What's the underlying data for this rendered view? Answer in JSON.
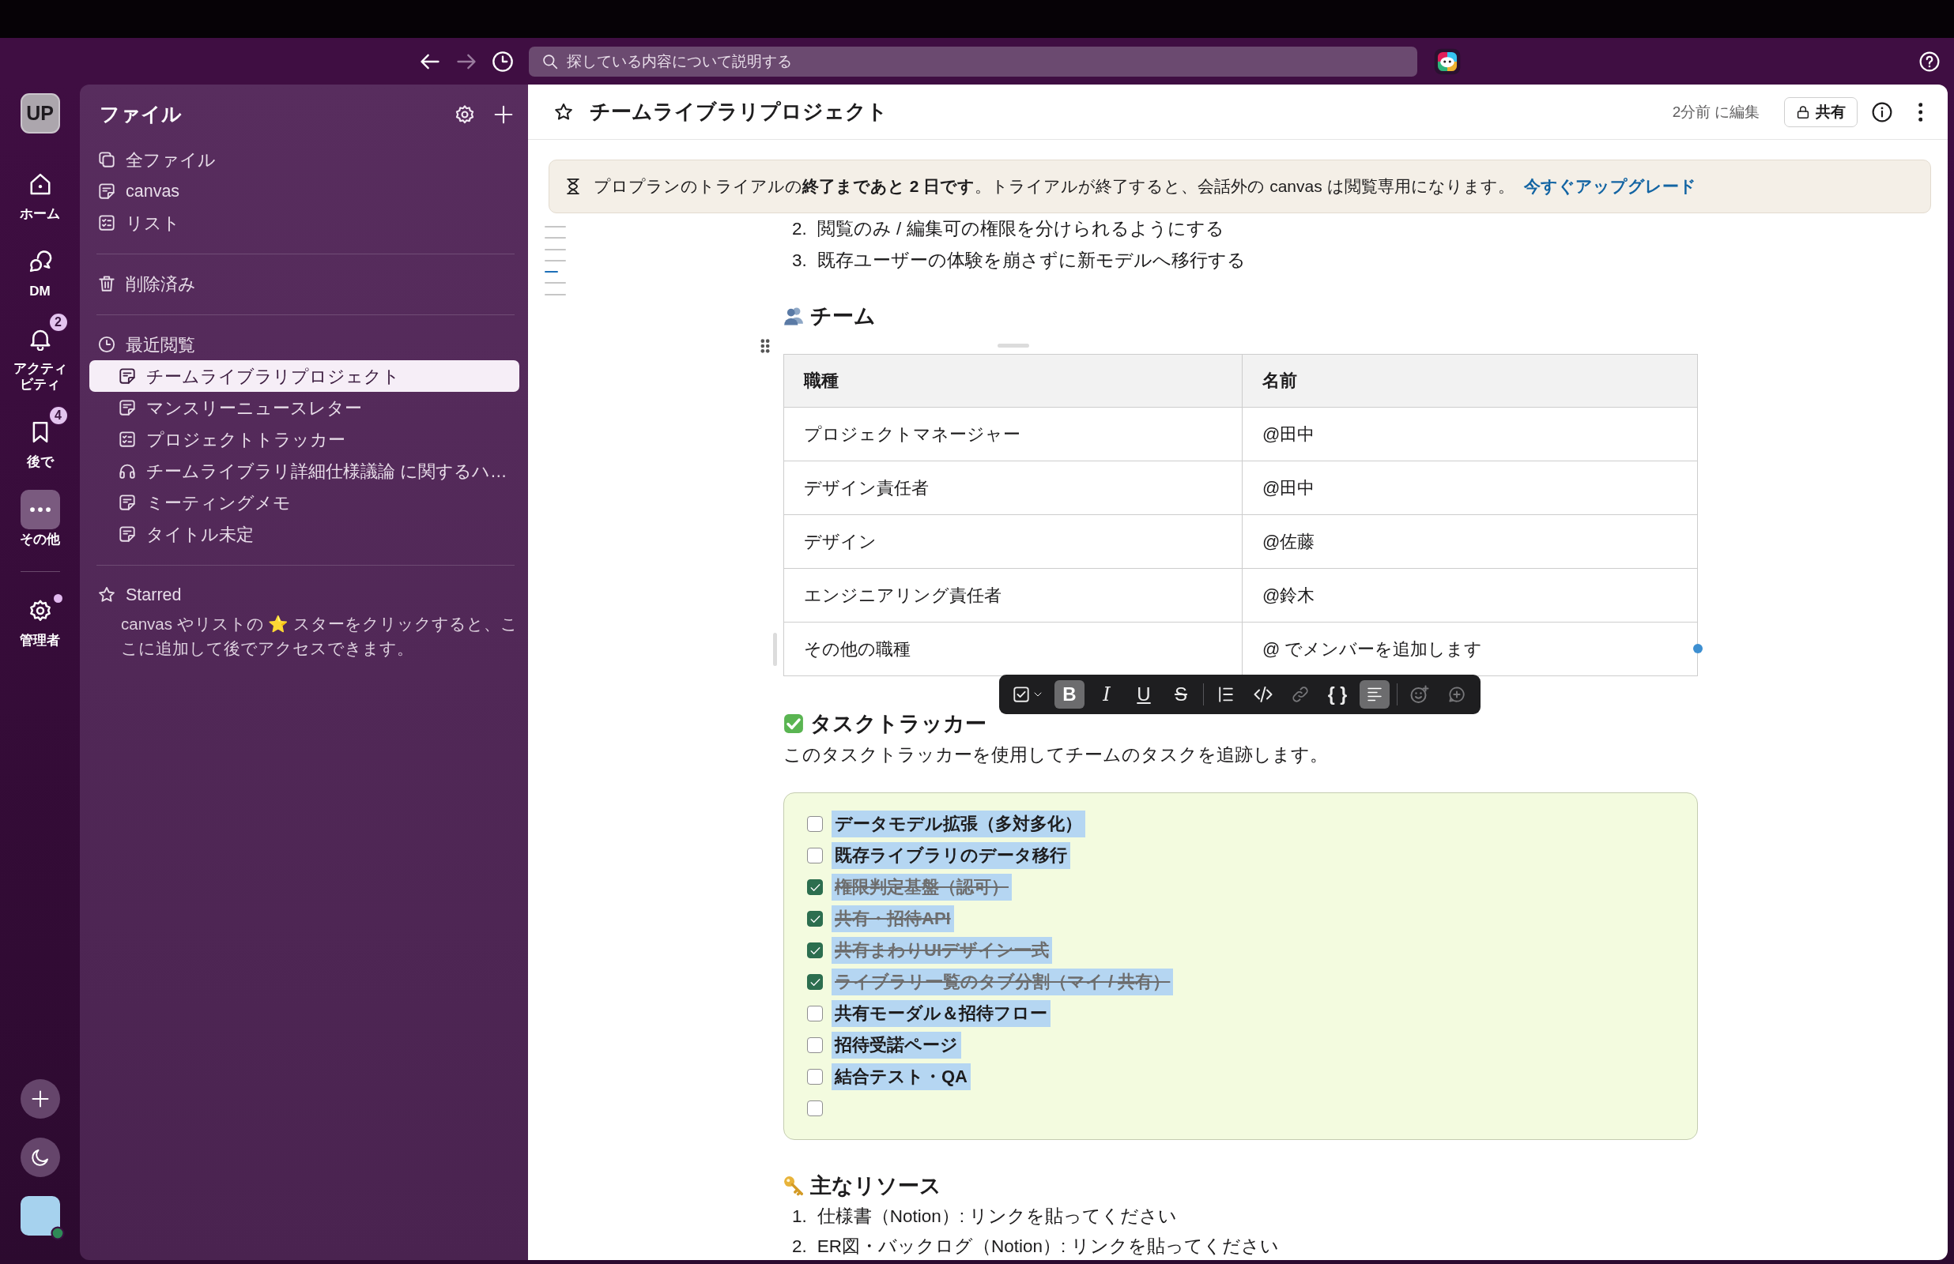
{
  "top_bar": {
    "nav": [
      {
        "kind": "back",
        "disabled": false
      },
      {
        "kind": "forward",
        "disabled": true
      },
      {
        "kind": "history",
        "disabled": false
      }
    ],
    "search": {
      "placeholder": "探している内容について説明する"
    }
  },
  "rail": {
    "workspace": "UP",
    "items": [
      {
        "kind": "home",
        "label": "ホーム",
        "selected": false
      },
      {
        "kind": "dm",
        "label": "DM",
        "selected": false
      },
      {
        "kind": "activity",
        "label": "アクティビティ",
        "badge": "2",
        "selected": false
      },
      {
        "kind": "later",
        "label": "後で",
        "badge": "4",
        "selected": false
      },
      {
        "kind": "more",
        "label": "その他",
        "selected": true
      }
    ],
    "admin": {
      "label": "管理者",
      "dot": true
    }
  },
  "sidebar": {
    "title": "ファイル",
    "items": [
      {
        "kind": "files",
        "label": "全ファイル",
        "selected": false
      },
      {
        "kind": "canvas",
        "label": "canvas",
        "selected": false
      },
      {
        "kind": "list",
        "label": "リスト",
        "selected": false
      }
    ],
    "trash": {
      "label": "削除済み",
      "selected": false
    },
    "recent": {
      "label": "最近閲覧",
      "items": [
        {
          "kind": "canvas",
          "label": "チームライブラリプロジェクト",
          "selected": true
        },
        {
          "kind": "canvas",
          "label": "マンスリーニュースレター",
          "selected": false
        },
        {
          "kind": "list",
          "label": "プロジェクトトラッカー",
          "selected": false
        },
        {
          "kind": "huddle",
          "label": "チームライブラリ詳細仕様議論 に関するハ…",
          "selected": false
        },
        {
          "kind": "canvas",
          "label": "ミーティングメモ",
          "selected": false
        },
        {
          "kind": "canvas",
          "label": "タイトル未定",
          "selected": false
        }
      ]
    },
    "starred": {
      "label": "Starred",
      "hint": "canvas やリストの ⭐ スターをクリックすると、ここに追加して後でアクセスできます。"
    }
  },
  "canvas": {
    "title": "チームライブラリプロジェクト",
    "edited": "2分前 に編集",
    "share": "共有",
    "banner": {
      "text": "プロプランのトライアルの**終了まであと 2 日です**。トライアルが終了すると、会話外の canvas は閲覧専用になります。",
      "link": "今すぐアップグレード"
    },
    "outline": [
      {
        "selected": false
      },
      {
        "selected": false
      },
      {
        "selected": false
      },
      {
        "selected": false
      },
      {
        "selected": true
      },
      {
        "selected": false
      },
      {
        "selected": false
      }
    ],
    "goals": [
      {
        "marker": "2.",
        "text": "閲覧のみ / 編集可の権限を分けられるようにする"
      },
      {
        "marker": "3.",
        "text": "既存ユーザーの体験を崩さずに新モデルへ移行する"
      }
    ],
    "team": {
      "heading": "チーム",
      "table": {
        "columns": [
          "職種",
          "名前"
        ],
        "rows": [
          [
            "プロジェクトマネージャー",
            "@田中"
          ],
          [
            "デザイン責任者",
            "@田中"
          ],
          [
            "デザイン",
            "@佐藤"
          ],
          [
            "エンジニアリング責任者",
            "@鈴木"
          ],
          [
            "その他の職種",
            "@ でメンバーを追加します"
          ]
        ]
      }
    },
    "toolbar": [
      {
        "kind": "checklist",
        "selected": false,
        "disabled": false
      },
      {
        "kind": "bold",
        "label": "B",
        "selected": true,
        "disabled": false
      },
      {
        "kind": "italic",
        "label": "I",
        "selected": false,
        "disabled": false
      },
      {
        "kind": "underline",
        "label": "U",
        "selected": false,
        "disabled": false
      },
      {
        "kind": "strike",
        "label": "S",
        "selected": false,
        "disabled": false
      },
      {
        "kind": "divider"
      },
      {
        "kind": "quote",
        "selected": false,
        "disabled": false
      },
      {
        "kind": "code",
        "selected": false,
        "disabled": false
      },
      {
        "kind": "link",
        "selected": false,
        "disabled": true
      },
      {
        "kind": "code_block",
        "label": "{ }",
        "selected": false,
        "disabled": false
      },
      {
        "kind": "paragraph",
        "selected": true,
        "disabled": false
      },
      {
        "kind": "divider"
      },
      {
        "kind": "emoji",
        "selected": false,
        "disabled": true
      },
      {
        "kind": "comment",
        "selected": false,
        "disabled": true
      }
    ],
    "tasks": {
      "heading": "タスクトラッカー",
      "description": "このタスクトラッカーを使用してチームのタスクを追跡します。",
      "items": [
        {
          "text": "データモデル拡張（多対多化）",
          "checked": false,
          "selected": true
        },
        {
          "text": "既存ライブラリのデータ移行",
          "checked": false,
          "selected": true
        },
        {
          "text": "権限判定基盤（認可）",
          "checked": true,
          "selected": true
        },
        {
          "text": "共有・招待API",
          "checked": true,
          "selected": true
        },
        {
          "text": "共有まわりUIデザイン一式",
          "checked": true,
          "selected": true
        },
        {
          "text": "ライブラリ一覧のタブ分割（マイ / 共有）",
          "checked": true,
          "selected": true
        },
        {
          "text": "共有モーダル＆招待フロー",
          "checked": false,
          "selected": true
        },
        {
          "text": "招待受諾ページ",
          "checked": false,
          "selected": true
        },
        {
          "text": "結合テスト・QA",
          "checked": false,
          "selected": true
        },
        {
          "checked": false
        }
      ]
    },
    "resources": {
      "heading": "主なリソース",
      "items": [
        {
          "marker": "1.",
          "text": "仕様書（Notion）: リンクを貼ってください"
        },
        {
          "marker": "2.",
          "text": "ER図・バックログ（Notion）: リンクを貼ってください"
        }
      ]
    }
  }
}
